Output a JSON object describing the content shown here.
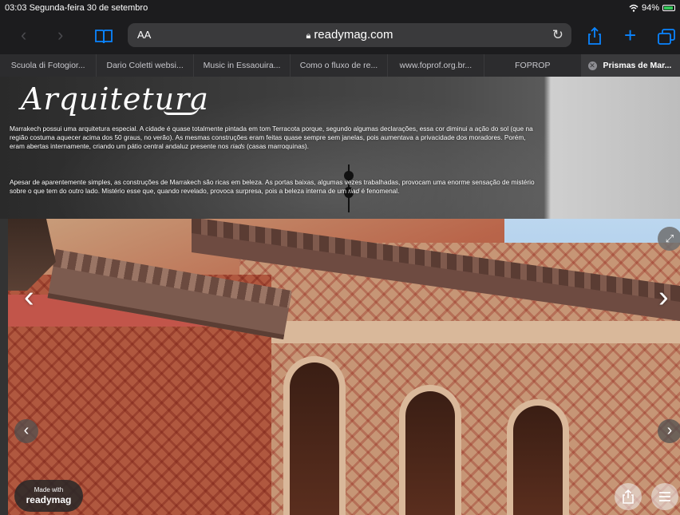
{
  "status_bar": {
    "time": "03:03",
    "date": "Segunda-feira 30 de setembro",
    "wifi_icon": "wifi-icon",
    "battery": "94%",
    "battery_color": "#34c759"
  },
  "toolbar": {
    "back_icon": "chevron-left-icon",
    "forward_icon": "chevron-right-icon",
    "bookmarks_icon": "book-icon",
    "text_size_label": "AA",
    "url": "readymag.com",
    "reload_icon": "reload-icon",
    "share_icon": "share-icon",
    "new_tab_icon": "plus-icon",
    "tabs_icon": "tabs-icon",
    "accent": "#0a84ff"
  },
  "tabs": [
    {
      "label": "Scuola di Fotogior..."
    },
    {
      "label": "Dario Coletti websi..."
    },
    {
      "label": "Music in Essaouira..."
    },
    {
      "label": "Como o fluxo de re..."
    },
    {
      "label": "www.foprof.org.br..."
    },
    {
      "label": "FOPROP"
    },
    {
      "label": "Prismas de Mar..."
    }
  ],
  "article": {
    "title": "Arquitetura",
    "paragraph1_a": "Marrakech possui uma arquitetura especial. A cidade é quase totalmente pintada em tom Terracota porque, segundo algumas declarações, essa cor diminui a ação do sol (que na região costuma aquecer acima dos 50 graus, no verão). As mesmas construções eram feitas quase sempre sem janelas, pois aumentava a privacidade  dos moradores. Porém, eram abertas internamente, criando um pátio central andaluz presente nos ",
    "paragraph1_em": "riads",
    "paragraph1_b": " (casas marroquinas).",
    "paragraph2_a": "Apesar de aparentemente simples, as construções de Marrakech são ricas em beleza. As portas baixas, algumas vezes trabalhadas, provocam uma enorme sensação de mistério sobre o que tem do outro lado. Mistério esse que, quando revelado, provoca surpresa, pois a beleza interna de um ",
    "paragraph2_em": "riad",
    "paragraph2_b": " é fenomenal."
  },
  "badge": {
    "small": "Made with",
    "brand": "readymag"
  },
  "controls": {
    "prev_icon": "chevron-left-icon",
    "next_icon": "chevron-right-icon",
    "expand_icon": "expand-icon",
    "share_icon": "share-icon",
    "menu_icon": "menu-icon"
  }
}
